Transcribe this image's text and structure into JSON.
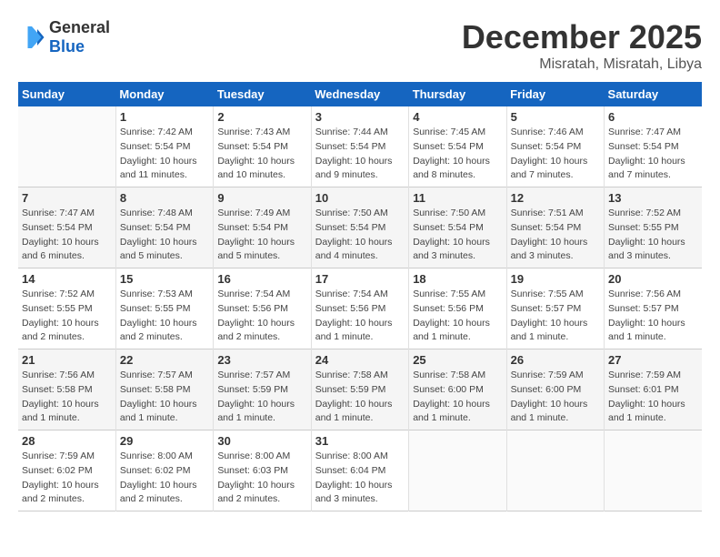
{
  "header": {
    "logo": {
      "general": "General",
      "blue": "Blue"
    },
    "title": "December 2025",
    "location": "Misratah, Misratah, Libya"
  },
  "calendar": {
    "days_of_week": [
      "Sunday",
      "Monday",
      "Tuesday",
      "Wednesday",
      "Thursday",
      "Friday",
      "Saturday"
    ],
    "weeks": [
      [
        {
          "num": "",
          "sunrise": "",
          "sunset": "",
          "daylight": ""
        },
        {
          "num": "1",
          "sunrise": "Sunrise: 7:42 AM",
          "sunset": "Sunset: 5:54 PM",
          "daylight": "Daylight: 10 hours and 11 minutes."
        },
        {
          "num": "2",
          "sunrise": "Sunrise: 7:43 AM",
          "sunset": "Sunset: 5:54 PM",
          "daylight": "Daylight: 10 hours and 10 minutes."
        },
        {
          "num": "3",
          "sunrise": "Sunrise: 7:44 AM",
          "sunset": "Sunset: 5:54 PM",
          "daylight": "Daylight: 10 hours and 9 minutes."
        },
        {
          "num": "4",
          "sunrise": "Sunrise: 7:45 AM",
          "sunset": "Sunset: 5:54 PM",
          "daylight": "Daylight: 10 hours and 8 minutes."
        },
        {
          "num": "5",
          "sunrise": "Sunrise: 7:46 AM",
          "sunset": "Sunset: 5:54 PM",
          "daylight": "Daylight: 10 hours and 7 minutes."
        },
        {
          "num": "6",
          "sunrise": "Sunrise: 7:47 AM",
          "sunset": "Sunset: 5:54 PM",
          "daylight": "Daylight: 10 hours and 7 minutes."
        }
      ],
      [
        {
          "num": "7",
          "sunrise": "Sunrise: 7:47 AM",
          "sunset": "Sunset: 5:54 PM",
          "daylight": "Daylight: 10 hours and 6 minutes."
        },
        {
          "num": "8",
          "sunrise": "Sunrise: 7:48 AM",
          "sunset": "Sunset: 5:54 PM",
          "daylight": "Daylight: 10 hours and 5 minutes."
        },
        {
          "num": "9",
          "sunrise": "Sunrise: 7:49 AM",
          "sunset": "Sunset: 5:54 PM",
          "daylight": "Daylight: 10 hours and 5 minutes."
        },
        {
          "num": "10",
          "sunrise": "Sunrise: 7:50 AM",
          "sunset": "Sunset: 5:54 PM",
          "daylight": "Daylight: 10 hours and 4 minutes."
        },
        {
          "num": "11",
          "sunrise": "Sunrise: 7:50 AM",
          "sunset": "Sunset: 5:54 PM",
          "daylight": "Daylight: 10 hours and 3 minutes."
        },
        {
          "num": "12",
          "sunrise": "Sunrise: 7:51 AM",
          "sunset": "Sunset: 5:54 PM",
          "daylight": "Daylight: 10 hours and 3 minutes."
        },
        {
          "num": "13",
          "sunrise": "Sunrise: 7:52 AM",
          "sunset": "Sunset: 5:55 PM",
          "daylight": "Daylight: 10 hours and 3 minutes."
        }
      ],
      [
        {
          "num": "14",
          "sunrise": "Sunrise: 7:52 AM",
          "sunset": "Sunset: 5:55 PM",
          "daylight": "Daylight: 10 hours and 2 minutes."
        },
        {
          "num": "15",
          "sunrise": "Sunrise: 7:53 AM",
          "sunset": "Sunset: 5:55 PM",
          "daylight": "Daylight: 10 hours and 2 minutes."
        },
        {
          "num": "16",
          "sunrise": "Sunrise: 7:54 AM",
          "sunset": "Sunset: 5:56 PM",
          "daylight": "Daylight: 10 hours and 2 minutes."
        },
        {
          "num": "17",
          "sunrise": "Sunrise: 7:54 AM",
          "sunset": "Sunset: 5:56 PM",
          "daylight": "Daylight: 10 hours and 1 minute."
        },
        {
          "num": "18",
          "sunrise": "Sunrise: 7:55 AM",
          "sunset": "Sunset: 5:56 PM",
          "daylight": "Daylight: 10 hours and 1 minute."
        },
        {
          "num": "19",
          "sunrise": "Sunrise: 7:55 AM",
          "sunset": "Sunset: 5:57 PM",
          "daylight": "Daylight: 10 hours and 1 minute."
        },
        {
          "num": "20",
          "sunrise": "Sunrise: 7:56 AM",
          "sunset": "Sunset: 5:57 PM",
          "daylight": "Daylight: 10 hours and 1 minute."
        }
      ],
      [
        {
          "num": "21",
          "sunrise": "Sunrise: 7:56 AM",
          "sunset": "Sunset: 5:58 PM",
          "daylight": "Daylight: 10 hours and 1 minute."
        },
        {
          "num": "22",
          "sunrise": "Sunrise: 7:57 AM",
          "sunset": "Sunset: 5:58 PM",
          "daylight": "Daylight: 10 hours and 1 minute."
        },
        {
          "num": "23",
          "sunrise": "Sunrise: 7:57 AM",
          "sunset": "Sunset: 5:59 PM",
          "daylight": "Daylight: 10 hours and 1 minute."
        },
        {
          "num": "24",
          "sunrise": "Sunrise: 7:58 AM",
          "sunset": "Sunset: 5:59 PM",
          "daylight": "Daylight: 10 hours and 1 minute."
        },
        {
          "num": "25",
          "sunrise": "Sunrise: 7:58 AM",
          "sunset": "Sunset: 6:00 PM",
          "daylight": "Daylight: 10 hours and 1 minute."
        },
        {
          "num": "26",
          "sunrise": "Sunrise: 7:59 AM",
          "sunset": "Sunset: 6:00 PM",
          "daylight": "Daylight: 10 hours and 1 minute."
        },
        {
          "num": "27",
          "sunrise": "Sunrise: 7:59 AM",
          "sunset": "Sunset: 6:01 PM",
          "daylight": "Daylight: 10 hours and 1 minute."
        }
      ],
      [
        {
          "num": "28",
          "sunrise": "Sunrise: 7:59 AM",
          "sunset": "Sunset: 6:02 PM",
          "daylight": "Daylight: 10 hours and 2 minutes."
        },
        {
          "num": "29",
          "sunrise": "Sunrise: 8:00 AM",
          "sunset": "Sunset: 6:02 PM",
          "daylight": "Daylight: 10 hours and 2 minutes."
        },
        {
          "num": "30",
          "sunrise": "Sunrise: 8:00 AM",
          "sunset": "Sunset: 6:03 PM",
          "daylight": "Daylight: 10 hours and 2 minutes."
        },
        {
          "num": "31",
          "sunrise": "Sunrise: 8:00 AM",
          "sunset": "Sunset: 6:04 PM",
          "daylight": "Daylight: 10 hours and 3 minutes."
        },
        {
          "num": "",
          "sunrise": "",
          "sunset": "",
          "daylight": ""
        },
        {
          "num": "",
          "sunrise": "",
          "sunset": "",
          "daylight": ""
        },
        {
          "num": "",
          "sunrise": "",
          "sunset": "",
          "daylight": ""
        }
      ]
    ]
  }
}
